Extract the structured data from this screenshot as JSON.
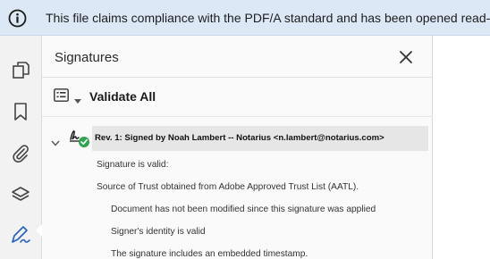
{
  "banner": {
    "message": "This file claims compliance with the PDF/A standard and has been opened read-only to prevent modification."
  },
  "icons": {
    "info": "info-circle-icon",
    "rail": [
      "copy-pages-icon",
      "bookmark-icon",
      "paperclip-icon",
      "layers-icon",
      "signature-pen-icon"
    ],
    "close": "close-icon",
    "options": "options-menu-icon",
    "expand": "chevron-down-icon",
    "signature": "signature-valid-icon"
  },
  "colors": {
    "banner_bg": "#dde8f6",
    "valid_green": "#2ea44f",
    "active_tool": "#2563c9"
  },
  "panel": {
    "title": "Signatures",
    "validate_all": "Validate All",
    "signature": {
      "label": "Rev. 1: Signed by Noah Lambert -- Notarius <n.lambert@notarius.com>",
      "details": [
        "Signature is valid:",
        "Source of Trust obtained from Adobe Approved Trust List (AATL).",
        "Document has not been modified since this signature was applied",
        "Signer's identity is valid",
        "The signature includes an embedded timestamp."
      ]
    }
  }
}
